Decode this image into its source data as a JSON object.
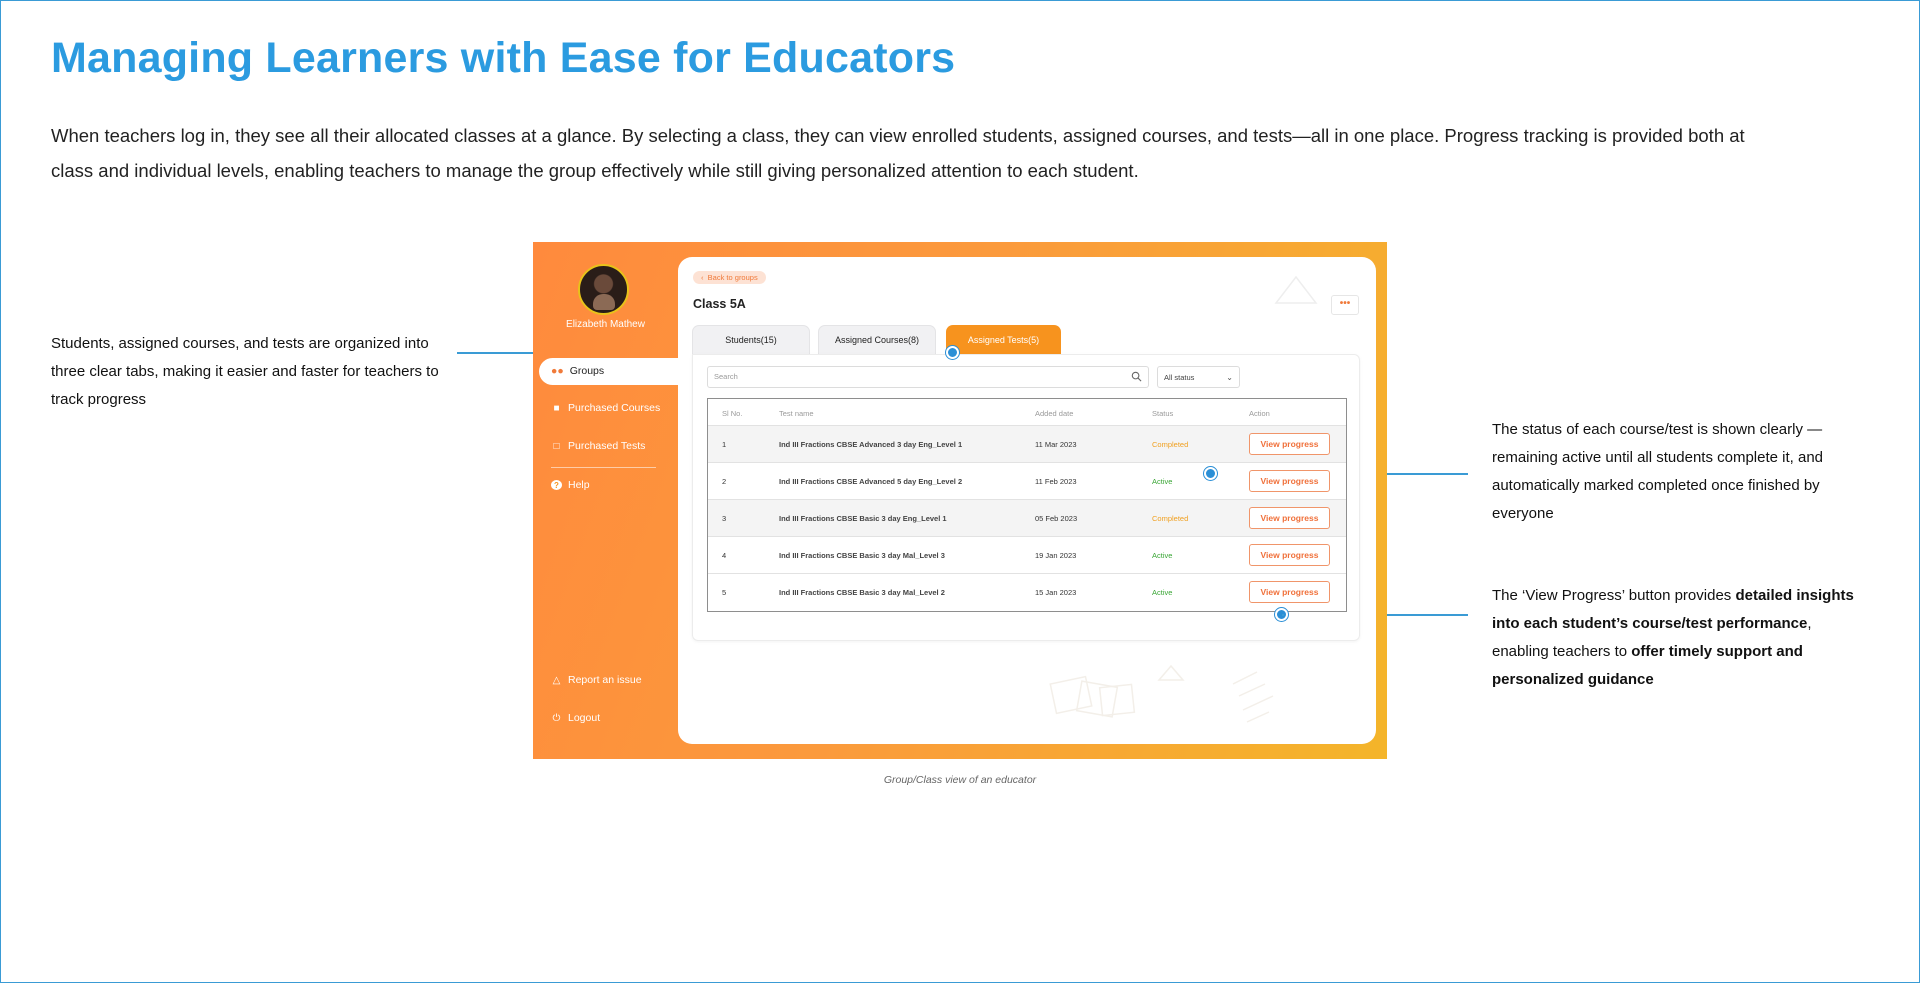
{
  "title": "Managing Learners with Ease for Educators",
  "intro": "When teachers log in, they see all their allocated classes at a glance. By selecting a class, they can view enrolled students, assigned courses, and tests—all in one place. Progress tracking is provided both at class and individual levels, enabling teachers to manage the group effectively while still giving personalized attention to each student.",
  "callouts": {
    "tabs": "Students, assigned courses, and tests are organized into three clear tabs, making it easier and faster for teachers to track progress",
    "status": "The status of each course/test is shown clearly — remaining active until all students complete it, and automatically marked completed once finished by everyone",
    "progress_pre": "The ‘View Progress’ button provides ",
    "progress_b1": "detailed insights into each student’s course/test performance",
    "progress_mid": ", enabling teachers to ",
    "progress_b2": "offer timely support and personalized guidance"
  },
  "caption": "Group/Class view of an educator",
  "colors": {
    "accent": "#2b9be0",
    "orange": "#f7931e",
    "completed": "#f0a020",
    "active": "#3aa636"
  },
  "app": {
    "user_name": "Elizabeth Mathew",
    "nav": {
      "groups": "Groups",
      "purchased_courses": "Purchased Courses",
      "purchased_tests": "Purchased Tests",
      "help": "Help",
      "report": "Report an issue",
      "logout": "Logout"
    },
    "back_label": "Back to groups",
    "class_title": "Class 5A",
    "more_label": "•••",
    "tabs": [
      "Students(15)",
      "Assigned Courses(8)",
      "Assigned Tests(5)"
    ],
    "active_tab": "Assigned Tests(5)",
    "search_placeholder": "Search",
    "status_filter": "All status",
    "columns": [
      "Sl No.",
      "Test name",
      "Added date",
      "Status",
      "Action"
    ],
    "rows": [
      {
        "no": "1",
        "name": "Ind III Fractions CBSE Advanced 3 day Eng_Level 1",
        "date": "11 Mar 2023",
        "status": "Completed",
        "action": "View progress"
      },
      {
        "no": "2",
        "name": "Ind III Fractions CBSE Advanced 5 day Eng_Level 2",
        "date": "11 Feb 2023",
        "status": "Active",
        "action": "View progress"
      },
      {
        "no": "3",
        "name": "Ind III Fractions CBSE Basic 3 day Eng_Level 1",
        "date": "05 Feb 2023",
        "status": "Completed",
        "action": "View progress"
      },
      {
        "no": "4",
        "name": "Ind III Fractions CBSE Basic 3 day Mal_Level 3",
        "date": "19 Jan 2023",
        "status": "Active",
        "action": "View progress"
      },
      {
        "no": "5",
        "name": "Ind III Fractions CBSE Basic 3 day Mal_Level 2",
        "date": "15 Jan 2023",
        "status": "Active",
        "action": "View progress"
      }
    ]
  }
}
